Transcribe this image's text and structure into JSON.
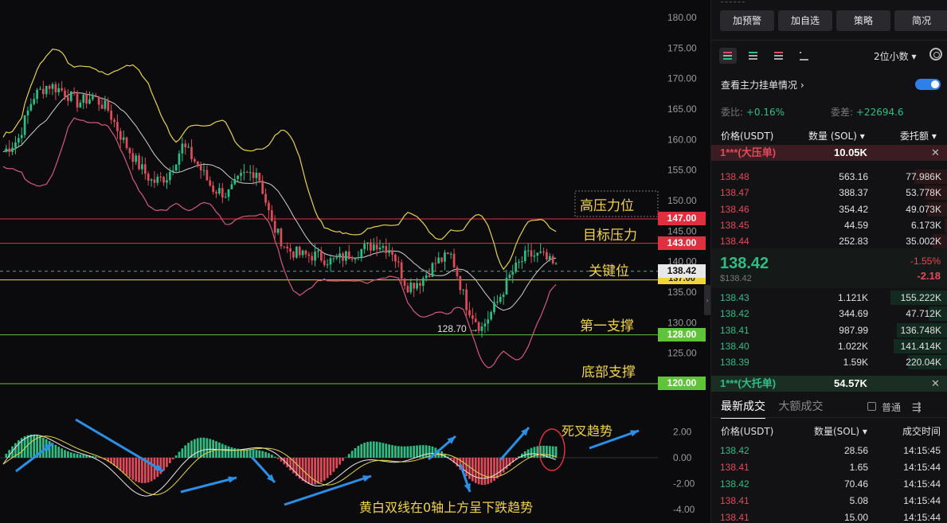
{
  "chart": {
    "y_axis_ticks": [
      "180.00",
      "175.00",
      "170.00",
      "165.00",
      "160.00",
      "155.00",
      "150.00",
      "145.00",
      "140.00",
      "135.00",
      "130.00",
      "125.00",
      "120.00"
    ],
    "macd_axis_ticks": [
      "2.00",
      "0.00",
      "-2.00",
      "-4.00"
    ],
    "current_price_tag": "138.42",
    "level_tags": [
      {
        "value": "147.00",
        "color": "#e0303f"
      },
      {
        "value": "143.00",
        "color": "#e0303f"
      },
      {
        "value": "137.00",
        "color": "#f2d53c"
      },
      {
        "value": "128.00",
        "color": "#5fc43a"
      },
      {
        "value": "120.00",
        "color": "#5fc43a"
      }
    ],
    "level_labels": {
      "high_pressure": "高压力位",
      "target_pressure": "目标压力",
      "key_level": "关键位",
      "first_support": "第一支撑",
      "bottom_support": "底部支撑"
    },
    "low_note": "128.70 →",
    "macd_annotations": {
      "death_cross": "死叉趋势",
      "macd_desc": "黄白双线在0轴上方呈下跌趋势"
    },
    "chart_data": {
      "type": "candlestick",
      "title": "",
      "ylim": [
        120,
        180
      ],
      "horizontal_levels": [
        147.0,
        143.0,
        138.42,
        137.0,
        128.0,
        120.0
      ],
      "approx_close_path": [
        158,
        160,
        167,
        169,
        168,
        166,
        167,
        165,
        160,
        156,
        153,
        154,
        159,
        156,
        152,
        151,
        154,
        155,
        146,
        142,
        141,
        141,
        140,
        141,
        142,
        143,
        142,
        136,
        137,
        140,
        141,
        133,
        129,
        133,
        138,
        141,
        141,
        139
      ]
    }
  },
  "panel": {
    "buttons": [
      "加预警",
      "加自选",
      "策略",
      "简况"
    ],
    "decimal_select": "2位小数 ▾",
    "watch_label": "查看主力挂单情况",
    "ratio_label": "委比:",
    "ratio_value": "+0.16%",
    "diff_label": "委差:",
    "diff_value": "+22694.6",
    "book_headers": {
      "price": "价格(USDT)",
      "qty": "数量 (SOL) ▾",
      "total": "委托额 ▾"
    },
    "ask_banner": {
      "name": "1***(大压单)",
      "value": "10.05K",
      "close": "✕"
    },
    "asks": [
      {
        "price": "138.48",
        "qty": "563.16",
        "total": "77.986K"
      },
      {
        "price": "138.47",
        "qty": "388.37",
        "total": "53.778K"
      },
      {
        "price": "138.46",
        "qty": "354.42",
        "total": "49.073K"
      },
      {
        "price": "138.45",
        "qty": "44.59",
        "total": "6.173K"
      },
      {
        "price": "138.44",
        "qty": "252.83",
        "total": "35.002K"
      }
    ],
    "mid": {
      "price": "138.42",
      "sub": "$138.42",
      "pct": "-1.55%",
      "chg": "-2.18"
    },
    "bids": [
      {
        "price": "138.43",
        "qty": "1.121K",
        "total": "155.222K"
      },
      {
        "price": "138.42",
        "qty": "344.69",
        "total": "47.712K"
      },
      {
        "price": "138.41",
        "qty": "987.99",
        "total": "136.748K"
      },
      {
        "price": "138.40",
        "qty": "1.022K",
        "total": "141.414K"
      },
      {
        "price": "138.39",
        "qty": "1.59K",
        "total": "220.04K"
      }
    ],
    "bid_banner": {
      "name": "1***(大托单)",
      "value": "54.57K",
      "close": "✕"
    },
    "tabs": {
      "latest": "最新成交",
      "large": "大额成交"
    },
    "checkbox_label": "普通",
    "trade_headers": {
      "price": "价格(USDT)",
      "qty": "数量(SOL) ▾",
      "time": "成交时间"
    },
    "trades": [
      {
        "price": "138.42",
        "qty": "28.56",
        "time": "14:15:45",
        "side": "buy"
      },
      {
        "price": "138.41",
        "qty": "1.65",
        "time": "14:15:44",
        "side": "sell"
      },
      {
        "price": "138.42",
        "qty": "70.46",
        "time": "14:15:44",
        "side": "buy"
      },
      {
        "price": "138.41",
        "qty": "5.08",
        "time": "14:15:44",
        "side": "sell"
      },
      {
        "price": "138.41",
        "qty": "15.00",
        "time": "14:15:44",
        "side": "sell"
      }
    ]
  }
}
